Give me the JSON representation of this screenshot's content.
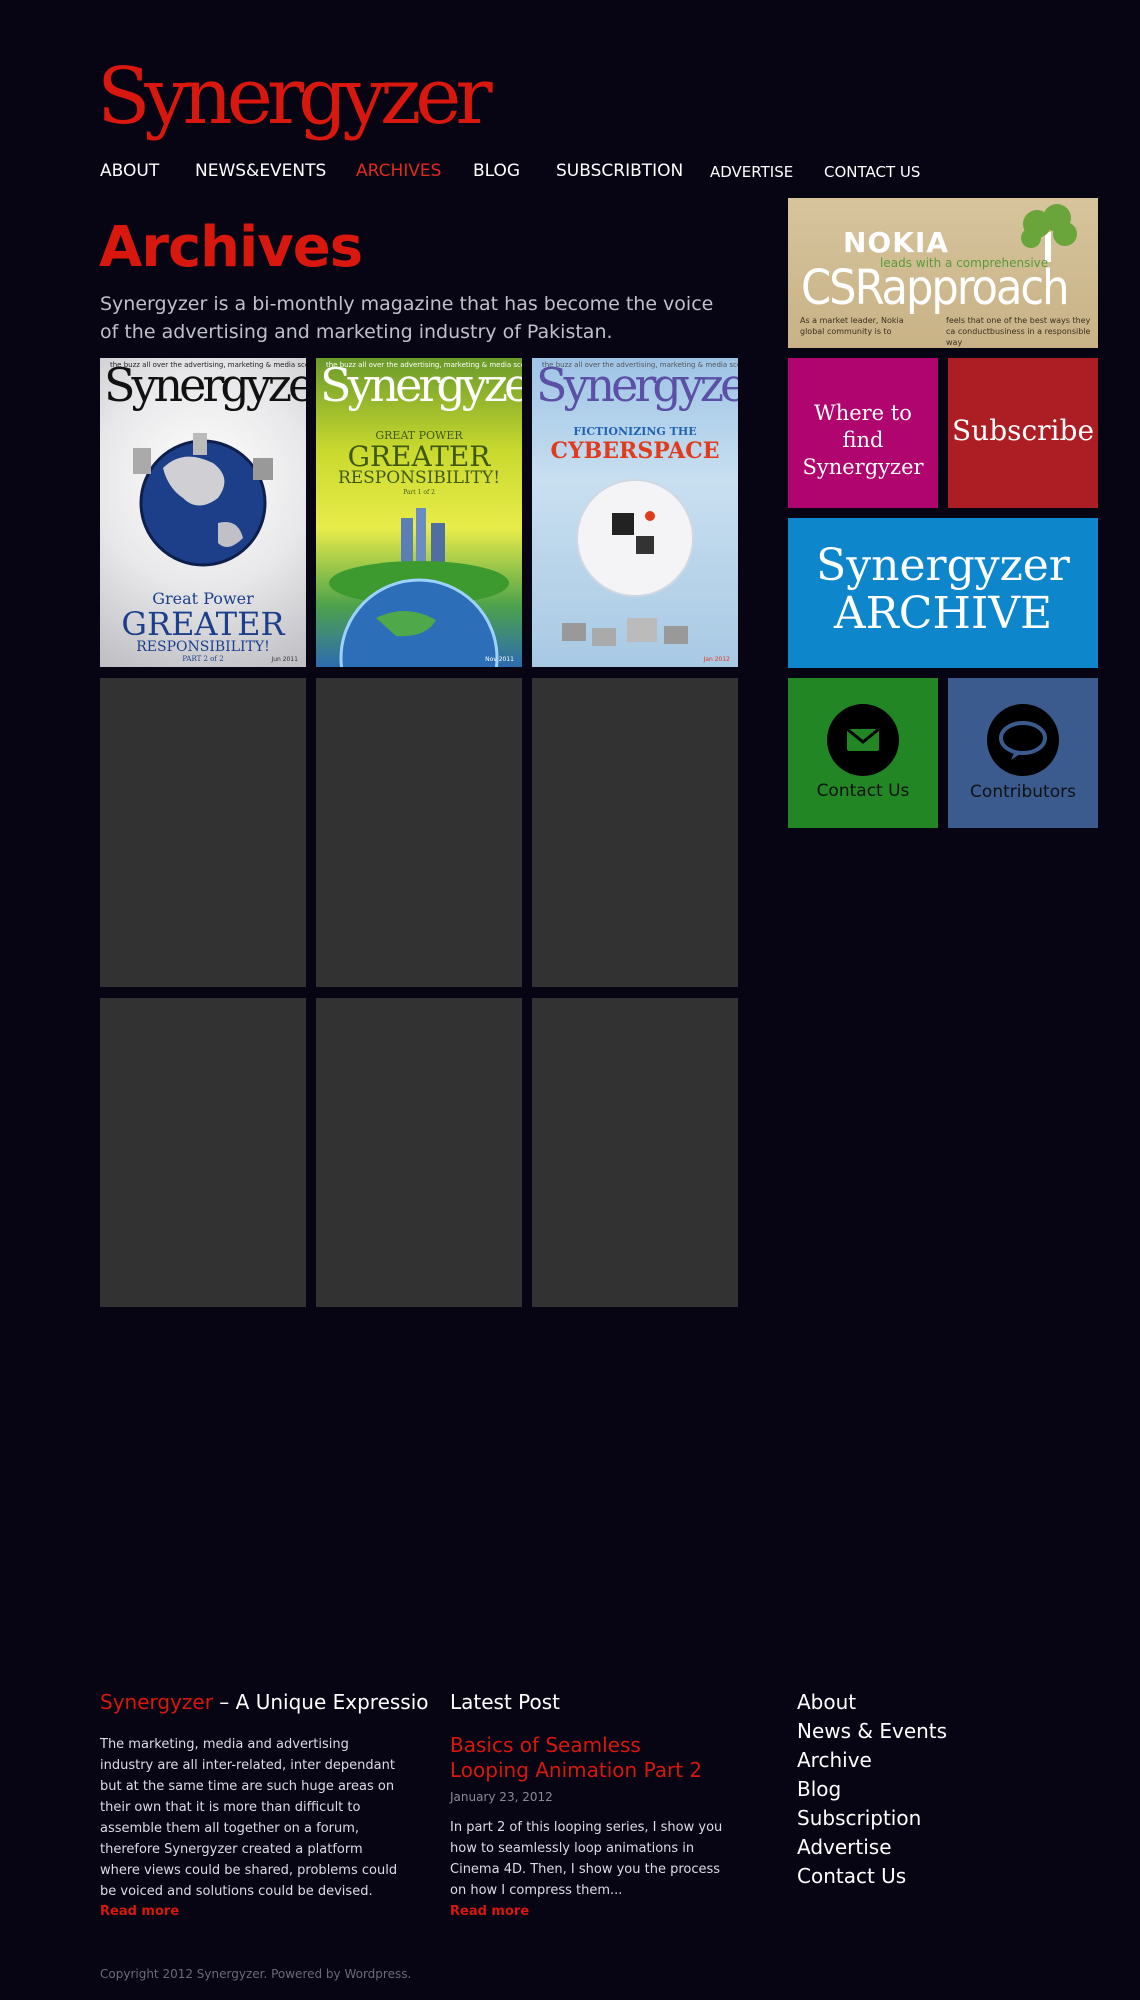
{
  "site": {
    "logo": "Synergyzer"
  },
  "nav": [
    {
      "label": "ABOUT",
      "active": false
    },
    {
      "label": "NEWS&EVENTS",
      "active": false
    },
    {
      "label": "ARCHIVES",
      "active": true
    },
    {
      "label": "BLOG",
      "active": false
    },
    {
      "label": "SUBSCRIBTION",
      "active": false
    },
    {
      "label": "ADVERTISE",
      "active": false
    },
    {
      "label": "CONTACT US",
      "active": false
    }
  ],
  "archives": {
    "title": "Archives",
    "description": "Synergyzer is a bi-monthly magazine that has become the voice of the advertising and marketing industry of Pakistan.",
    "covers": [
      {
        "masthead": "Synergyzer",
        "tagline": "the buzz all over the advertising, marketing & media scene",
        "headline_top": "Great Power",
        "headline_main": "GREATER",
        "headline_sub": "RESPONSIBILITY!",
        "part": "PART 2 of 2",
        "issue": "Jun 2011"
      },
      {
        "masthead": "Synergyzer",
        "tagline": "the buzz all over the advertising, marketing & media scene",
        "headline_top": "GREAT POWER",
        "headline_main": "GREATER",
        "headline_sub": "RESPONSIBILITY!",
        "part": "Part 1 of 2",
        "issue": "Nov 2011"
      },
      {
        "masthead": "Synergyzer",
        "tagline": "the buzz all over the advertising, marketing & media scene",
        "headline_top": "FICTIONIZING THE",
        "headline_main": "CYBERSPACE",
        "headline_sub": "",
        "part": "",
        "issue": "Jan 2012"
      }
    ],
    "empty_slots": 6
  },
  "sidebar": {
    "banner": {
      "brand": "NOKIA",
      "leads": "leads with a comprehensive",
      "headline": "CSRapproach",
      "text_left": "As a market leader, Nokia global community is to",
      "text_right": "feels that one of the best ways they ca conductbusiness in a responsible way"
    },
    "where_to_find": "Where to find Synergyzer",
    "subscribe": "Subscribe",
    "archive_line1": "Synergyzer",
    "archive_line2": "ARCHIVE",
    "contact": "Contact Us",
    "contributors": "Contributors",
    "colors": {
      "where": "#b0046f",
      "subscribe": "#ad1d24",
      "archive": "#0e86cb",
      "contact": "#228625",
      "contributors": "#3b5b8f"
    }
  },
  "footer": {
    "about_brand": "Synergyzer",
    "about_title": " – A Unique Expressio",
    "about_text": "The marketing, media and advertising industry are all inter-related, inter dependant but at the same time are such huge areas on their own that it is more than difficult to assemble them all together on a forum, therefore Synergyzer created a platform where views could be shared, problems could be voiced and solutions could be devised.",
    "about_read_more": "Read more",
    "latest_title": "Latest Post",
    "post_title": "Basics of Seamless Looping Animation Part 2",
    "post_date": "January 23, 2012",
    "post_excerpt": "In part 2 of this looping series, I show you how to seamlessly loop animations in Cinema 4D. Then, I show you the process on how I compress them...",
    "post_read_more": "Read more",
    "links": [
      "About",
      "News & Events",
      "Archive",
      "Blog",
      "Subscription",
      "Advertise",
      "Contact Us"
    ],
    "copyright": "Copyright 2012 Synergyzer. Powered by Wordpress."
  }
}
